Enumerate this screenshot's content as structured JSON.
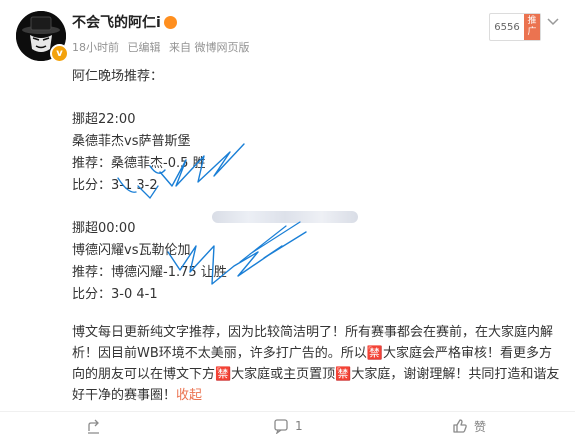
{
  "post": {
    "author": "不会飞的阿仁i",
    "badge_icon": "verified-v-icon",
    "time": "18小时前",
    "edited": "已编辑",
    "source": "来自 微博网页版",
    "read_count": "6556",
    "promote_label": "推广",
    "intro": "阿仁晚场推荐：",
    "match1": {
      "time": "挪超22:00",
      "teams": "桑德菲杰vs萨普斯堡",
      "pick": "推荐：桑德菲杰-0.5 胜",
      "score": "比分：3-1 3-2"
    },
    "match2": {
      "time": "挪超00:00",
      "teams": "博德闪耀vs瓦勒伦加",
      "pick": "推荐：博德闪耀-1.75 让胜",
      "score": "比分：3-0 4-1"
    },
    "paragraph": "博文每日更新纯文字推荐，因为比较简洁明了！所有赛事都会在赛前，在大家庭内解析！因目前WB环境不太美丽，许多打广告的。所以🈲大家庭会严格审核！看更多方向的朋友可以在博文下方🈲大家庭或主页置顶🈲大家庭，谢谢理解！共同打造和谐友好干净的赛事圈！",
    "collapse_label": "收起"
  },
  "actions": {
    "share": "",
    "comment_count": "",
    "repost_count": "1",
    "like_label": "赞"
  },
  "colors": {
    "accent": "#eb7350",
    "doodle": "#1a7fd6"
  }
}
